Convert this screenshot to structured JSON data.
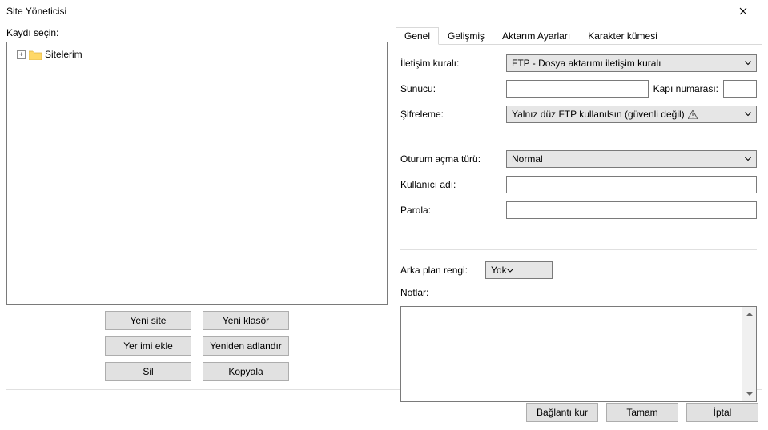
{
  "window": {
    "title": "Site Yöneticisi"
  },
  "left": {
    "select_label": "Kaydı seçin:",
    "tree_root": "Sitelerim",
    "buttons": {
      "new_site": "Yeni site",
      "new_folder": "Yeni klasör",
      "bookmark": "Yer imi ekle",
      "rename": "Yeniden adlandır",
      "delete": "Sil",
      "copy": "Kopyala"
    }
  },
  "tabs": {
    "general": "Genel",
    "advanced": "Gelişmiş",
    "transfer": "Aktarım Ayarları",
    "charset": "Karakter kümesi"
  },
  "form": {
    "protocol_label": "İletişim kuralı:",
    "protocol_value": "FTP - Dosya aktarımı iletişim kuralı",
    "host_label": "Sunucu:",
    "port_label": "Kapı numarası:",
    "encryption_label": "Şifreleme:",
    "encryption_value": "Yalnız düz FTP kullanılsın (güvenli değil)",
    "logon_label": "Oturum açma türü:",
    "logon_value": "Normal",
    "user_label": "Kullanıcı adı:",
    "pass_label": "Parola:",
    "bgcolor_label": "Arka plan rengi:",
    "bgcolor_value": "Yok",
    "notes_label": "Notlar:"
  },
  "footer": {
    "connect": "Bağlantı kur",
    "ok": "Tamam",
    "cancel": "İptal"
  }
}
